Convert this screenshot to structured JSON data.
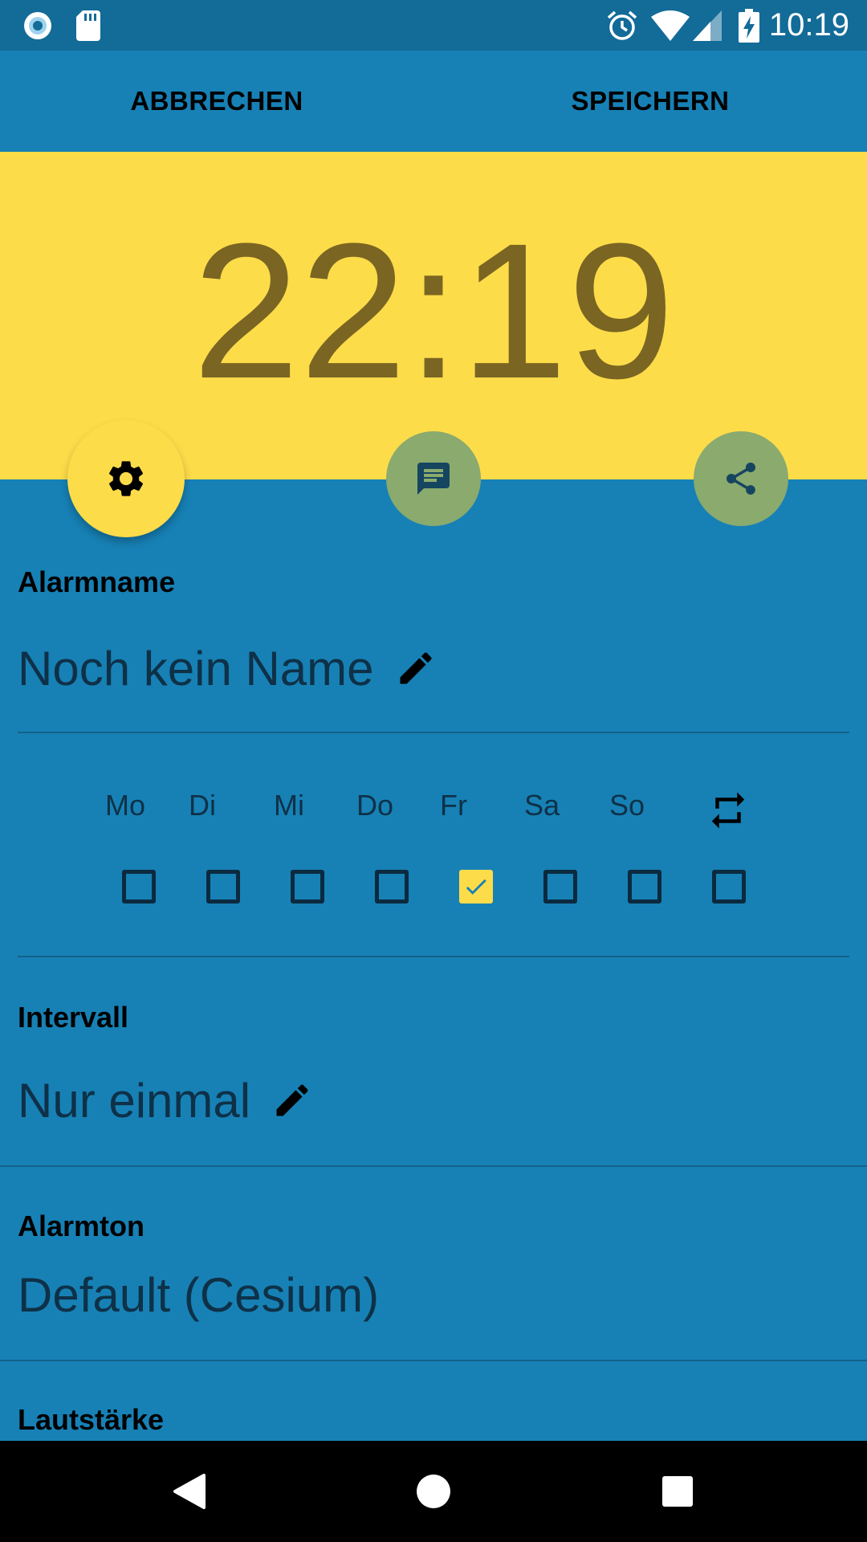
{
  "status_bar": {
    "time": "10:19",
    "left_icons": [
      "circle-notification-icon",
      "sd-card-icon"
    ],
    "right_icons": [
      "alarm-clock-icon",
      "wifi-icon",
      "cell-signal-icon",
      "battery-charging-icon"
    ]
  },
  "app_bar": {
    "cancel_label": "ABBRECHEN",
    "save_label": "SPEICHERN"
  },
  "alarm": {
    "time": "22:19"
  },
  "action_buttons": [
    "gear-icon",
    "message-icon",
    "share-icon"
  ],
  "alarm_name": {
    "label": "Alarmname",
    "value": "Noch kein Name"
  },
  "weekdays": {
    "days": [
      {
        "label": "Mo",
        "checked": false
      },
      {
        "label": "Di",
        "checked": false
      },
      {
        "label": "Mi",
        "checked": false
      },
      {
        "label": "Do",
        "checked": false
      },
      {
        "label": "Fr",
        "checked": true
      },
      {
        "label": "Sa",
        "checked": false
      },
      {
        "label": "So",
        "checked": false
      }
    ],
    "repeat_checked": false
  },
  "interval": {
    "label": "Intervall",
    "value": "Nur einmal"
  },
  "ringtone": {
    "label": "Alarmton",
    "value": "Default (Cesium)"
  },
  "volume": {
    "label": "Lautstärke"
  },
  "colors": {
    "primary": "#1781B5",
    "status_bar": "#136B98",
    "accent": "#FDDC4A",
    "time_text": "#7A6522",
    "value_text": "#0E3148"
  }
}
